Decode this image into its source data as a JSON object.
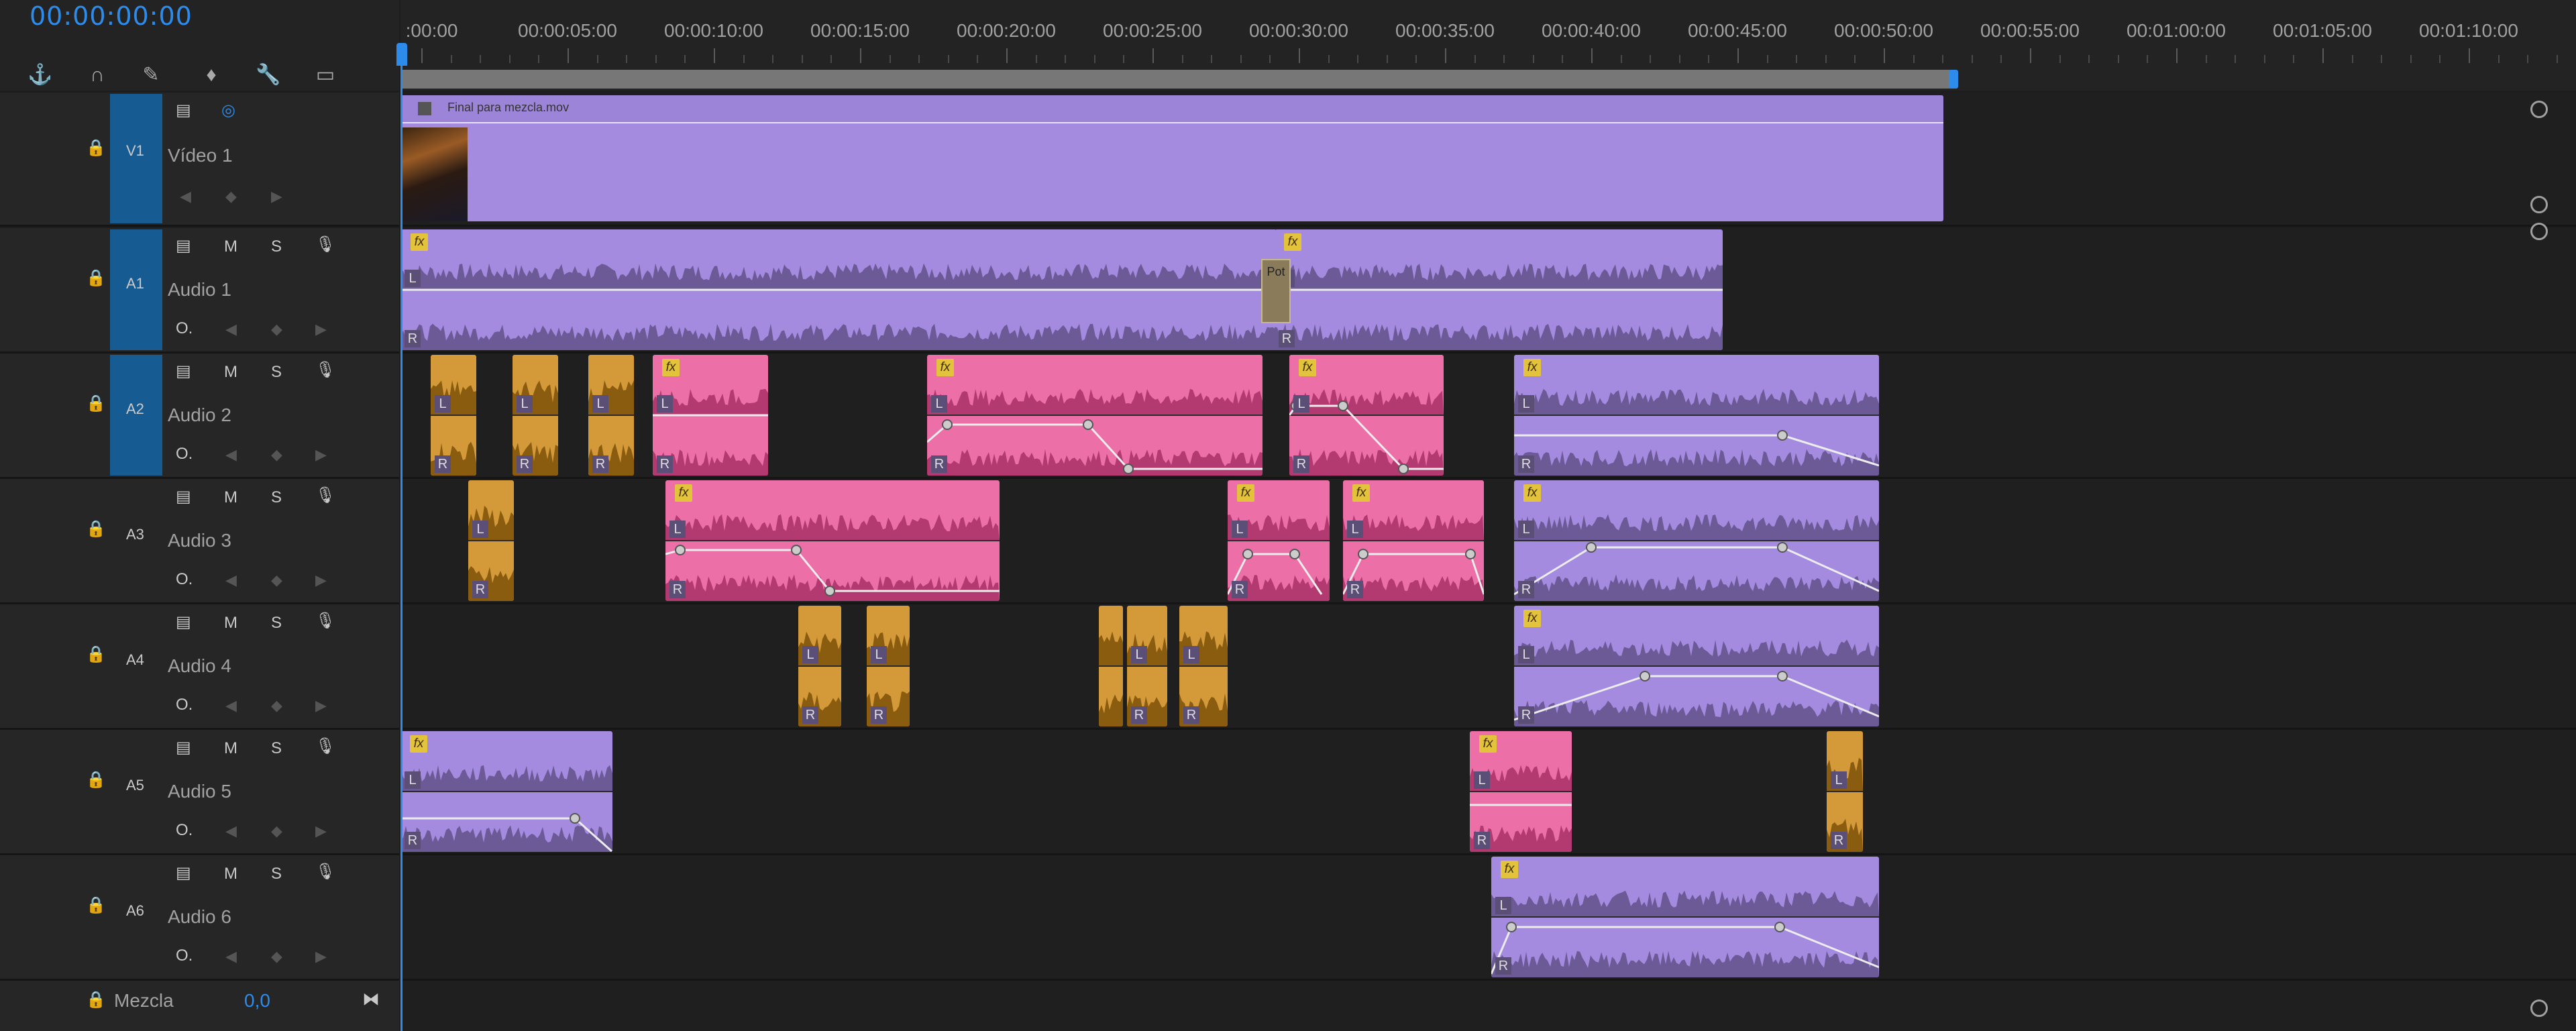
{
  "header": {
    "timecode": "00:00:00:00",
    "tools": [
      {
        "name": "snap-icon",
        "glyph": "⚓"
      },
      {
        "name": "linked-selection-icon",
        "glyph": "∩"
      },
      {
        "name": "add-marker-icon",
        "glyph": "✎"
      },
      {
        "name": "marker-icon",
        "glyph": "♦"
      },
      {
        "name": "wrench-icon",
        "glyph": "🔧"
      },
      {
        "name": "captions-icon",
        "glyph": "▭"
      }
    ]
  },
  "ruler": {
    "labels": [
      ":00:00",
      "00:00:05:00",
      "00:00:10:00",
      "00:00:15:00",
      "00:00:20:00",
      "00:00:25:00",
      "00:00:30:00",
      "00:00:35:00",
      "00:00:40:00",
      "00:00:45:00",
      "00:00:50:00",
      "00:00:55:00",
      "00:01:00:00",
      "00:01:05:00",
      "00:01:10:00"
    ]
  },
  "video_track": {
    "code": "V1",
    "name": "Vídeo 1",
    "clip_name": "Final para mezcla.mov"
  },
  "audio_tracks": [
    {
      "code": "A1",
      "name": "Audio 1",
      "m": "M",
      "s": "S"
    },
    {
      "code": "A2",
      "name": "Audio 2",
      "m": "M",
      "s": "S"
    },
    {
      "code": "A3",
      "name": "Audio 3",
      "m": "M",
      "s": "S"
    },
    {
      "code": "A4",
      "name": "Audio 4",
      "m": "M",
      "s": "S"
    },
    {
      "code": "A5",
      "name": "Audio 5",
      "m": "M",
      "s": "S"
    },
    {
      "code": "A6",
      "name": "Audio 6",
      "m": "M",
      "s": "S"
    }
  ],
  "mix": {
    "label": "Mezcla",
    "value": "0,0"
  },
  "transition_label": "Pot",
  "channel_labels": {
    "left": "L",
    "right": "R",
    "fx": "fx"
  },
  "colors": {
    "accent": "#2d8ceb",
    "target": "#175b93",
    "purple_clip": "#a48be0",
    "purple_wave": "#6c5a97",
    "pink_clip": "#ed6fa8",
    "pink_wave": "#b33a70",
    "gold_clip": "#d49a3a"
  }
}
